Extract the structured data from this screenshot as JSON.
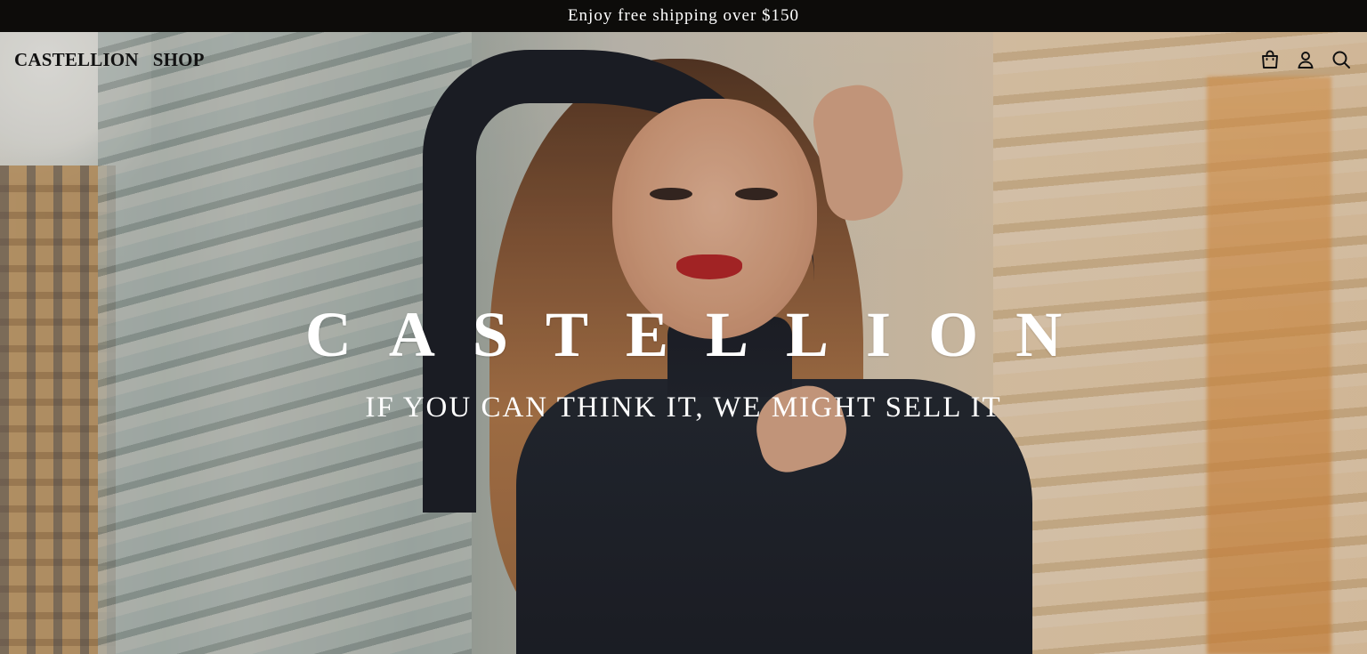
{
  "announcement": {
    "text": "Enjoy free shipping over $150"
  },
  "nav": {
    "brand": "CASTELLION",
    "shop": "SHOP",
    "icons": [
      "cart-icon",
      "account-icon",
      "search-icon"
    ]
  },
  "hero": {
    "title": "CASTELLION",
    "tagline": "IF YOU CAN THINK IT, WE MIGHT SELL IT"
  },
  "colors": {
    "announcement_bg": "#0d0c0a",
    "text_light": "#ffffff",
    "nav_text": "#111111"
  }
}
